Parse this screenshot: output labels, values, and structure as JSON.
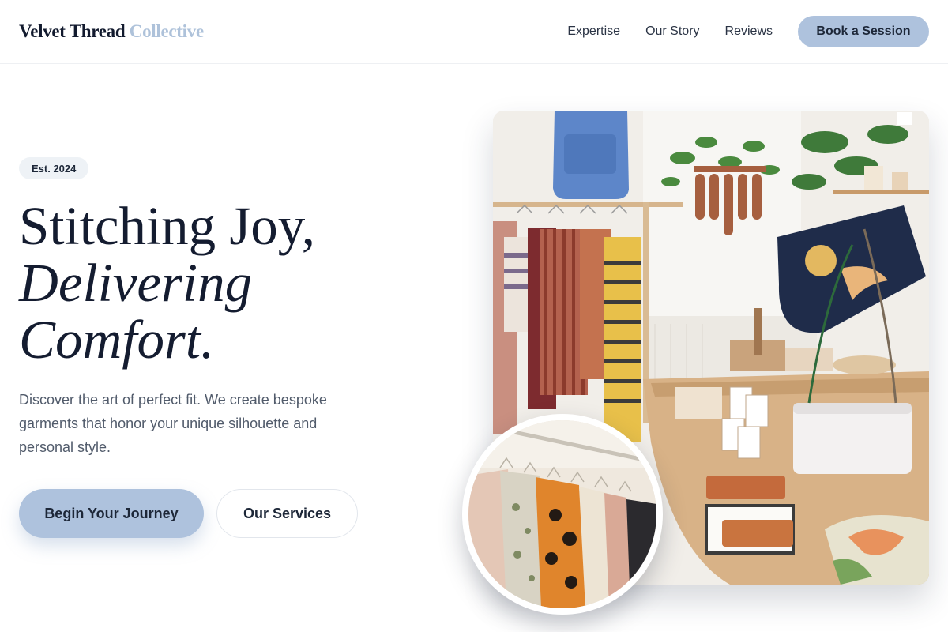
{
  "header": {
    "logo_main": "Velvet Thread",
    "logo_accent": "Collective",
    "nav": [
      "Expertise",
      "Our Story",
      "Reviews"
    ],
    "cta": "Book a Session"
  },
  "hero": {
    "badge": "Est. 2024",
    "headline_line1": "Stitching Joy,",
    "headline_line2": "Delivering",
    "headline_line3": "Comfort.",
    "description": "Discover the art of perfect fit. We create bespoke garments that honor your unique silhouette and personal style.",
    "primary_button": "Begin Your Journey",
    "secondary_button": "Our Services"
  },
  "colors": {
    "accent": "#aec2dd",
    "logo_accent": "#aec2da",
    "text_dark": "#141c30",
    "text_muted": "#515b6b"
  }
}
